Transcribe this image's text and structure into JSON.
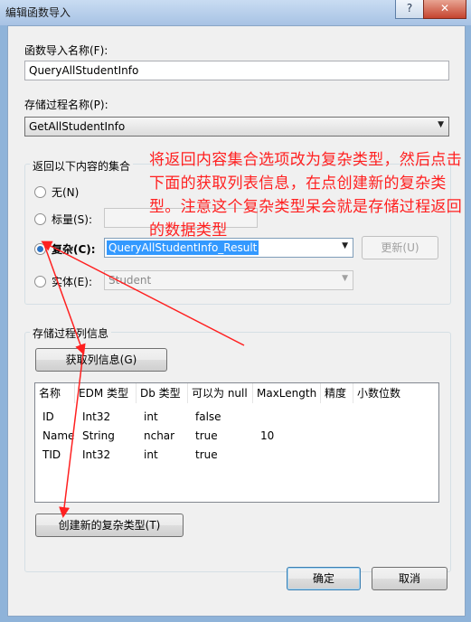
{
  "window": {
    "title": "编辑函数导入"
  },
  "titlebar": {
    "help_label": "?",
    "close_label": "✕"
  },
  "function_name": {
    "label": "函数导入名称(F):",
    "value": "QueryAllStudentInfo"
  },
  "stored_proc": {
    "label": "存储过程名称(P):",
    "value": "GetAllStudentInfo"
  },
  "return_group": {
    "title": "返回以下内容的集合",
    "options": [
      {
        "label": "无(N)"
      },
      {
        "label": "标量(S):"
      },
      {
        "label": "复杂(C):",
        "selected": true,
        "value": "QueryAllStudentInfo_Result"
      },
      {
        "label": "实体(E):",
        "value": "Student"
      }
    ],
    "update_button": "更新(U)"
  },
  "columns_group": {
    "title": "存储过程列信息",
    "get_columns_button": "获取列信息(G)",
    "headers": [
      "名称",
      "EDM 类型",
      "Db 类型",
      "可以为 null",
      "MaxLength",
      "精度",
      "小数位数"
    ],
    "rows": [
      [
        "ID",
        "Int32",
        "int",
        "false",
        "",
        "",
        ""
      ],
      [
        "Name",
        "String",
        "nchar",
        "true",
        "10",
        "",
        ""
      ],
      [
        "TID",
        "Int32",
        "int",
        "true",
        "",
        "",
        ""
      ]
    ],
    "create_complex_button": "创建新的复杂类型(T)"
  },
  "footer": {
    "ok_button": "确定",
    "cancel_button": "取消"
  },
  "annotation": {
    "text": "将返回内容集合选项改为复杂类型，然后点击下面的获取列表信息，在点创建新的复杂类型。注意这个复杂类型呆会就是存储过程返回的数据类型",
    "color": "#ff2020"
  },
  "colors": {
    "selection": "#3399ff",
    "titlebar": "#a7c2e4",
    "dialog_bg": "#f0f0f0"
  }
}
